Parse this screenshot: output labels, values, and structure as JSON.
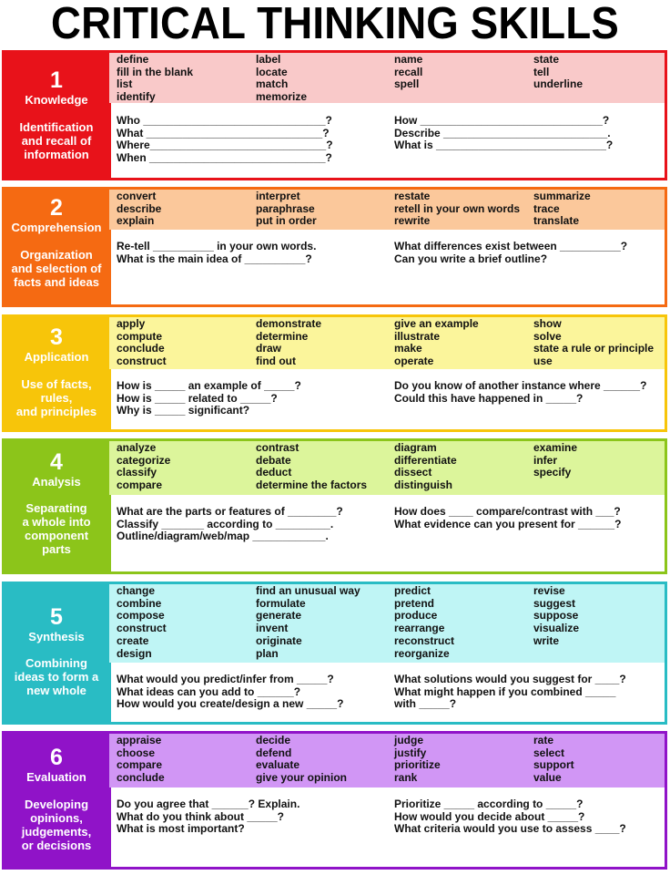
{
  "title": "CRITICAL THINKING SKILLS",
  "sections": [
    {
      "number": "1",
      "level": "Knowledge",
      "description": [
        "Identification",
        "and recall of",
        "information"
      ],
      "color": "#e8121a",
      "light_color": "#f9c9c9",
      "verbs": [
        [
          "define",
          "fill in the blank",
          "list",
          "identify"
        ],
        [
          "label",
          "locate",
          "match",
          "memorize"
        ],
        [
          "name",
          "recall",
          "spell"
        ],
        [
          "state",
          "tell",
          "underline"
        ]
      ],
      "questions_left": [
        "Who ______________________________?",
        "What _____________________________?",
        "Where_____________________________?",
        "When _____________________________?"
      ],
      "questions_right": [
        "How ______________________________?",
        "Describe ___________________________.",
        "What is ____________________________?"
      ]
    },
    {
      "number": "2",
      "level": "Comprehension",
      "description": [
        "Organization",
        "and selection of",
        "facts and ideas"
      ],
      "color": "#f56a12",
      "light_color": "#fbc89b",
      "verbs": [
        [
          "convert",
          "describe",
          "explain"
        ],
        [
          "interpret",
          "paraphrase",
          "put in order"
        ],
        [
          "restate",
          "retell in your own words",
          "rewrite"
        ],
        [
          "summarize",
          "trace",
          "translate"
        ]
      ],
      "questions_left": [
        "Re-tell __________ in your own words.",
        "What is the main idea of __________?"
      ],
      "questions_right": [
        "What differences exist between __________?",
        "Can you write a brief outline?"
      ]
    },
    {
      "number": "3",
      "level": "Application",
      "description": [
        "Use of facts,",
        "rules,",
        "and principles"
      ],
      "color": "#f7c50a",
      "light_color": "#fbf59b",
      "verbs": [
        [
          "apply",
          "compute",
          "conclude",
          "construct"
        ],
        [
          "demonstrate",
          "determine",
          "draw",
          "find out"
        ],
        [
          "give an example",
          "illustrate",
          "make",
          "operate"
        ],
        [
          "show",
          "solve",
          "state a rule or principle",
          "use"
        ]
      ],
      "questions_left": [
        "How is _____ an example of _____?",
        "How is _____ related to _____?",
        "Why is _____ significant?"
      ],
      "questions_right": [
        "Do you know of another instance where ______?",
        "Could this have happened in _____?"
      ]
    },
    {
      "number": "4",
      "level": "Analysis",
      "description": [
        "Separating",
        "a whole into",
        "component",
        "parts"
      ],
      "color": "#8cc51a",
      "light_color": "#dcf59b",
      "verbs": [
        [
          "analyze",
          "categorize",
          "classify",
          "compare"
        ],
        [
          "contrast",
          "debate",
          "deduct",
          "determine the factors"
        ],
        [
          "diagram",
          "differentiate",
          "dissect",
          "distinguish"
        ],
        [
          "examine",
          "infer",
          "specify"
        ]
      ],
      "questions_left": [
        "What are the parts or features of ________?",
        "Classify _______ according to _________.",
        "Outline/diagram/web/map ____________."
      ],
      "questions_right": [
        "How does ____ compare/contrast with ___?",
        "What evidence can you present for ______?"
      ]
    },
    {
      "number": "5",
      "level": "Synthesis",
      "description": [
        "Combining",
        "ideas to form a",
        "new whole"
      ],
      "color": "#29bcc4",
      "light_color": "#bff5f5",
      "verbs": [
        [
          "change",
          "combine",
          "compose",
          "construct",
          "create",
          "design"
        ],
        [
          "find an unusual way",
          "formulate",
          "generate",
          "invent",
          "originate",
          "plan"
        ],
        [
          "predict",
          "pretend",
          "produce",
          "rearrange",
          "reconstruct",
          "reorganize"
        ],
        [
          "revise",
          "suggest",
          "suppose",
          "visualize",
          "write"
        ]
      ],
      "questions_left": [
        "What would you predict/infer from _____?",
        "What ideas can you add to ______?",
        "How would you create/design a new _____?"
      ],
      "questions_right": [
        "What solutions would you suggest for ____?",
        "What might happen if you combined _____",
        "with _____?"
      ]
    },
    {
      "number": "6",
      "level": "Evaluation",
      "description": [
        "Developing",
        "opinions,",
        "judgements,",
        "or decisions"
      ],
      "color": "#9013c8",
      "light_color": "#d196f5",
      "verbs": [
        [
          "appraise",
          "choose",
          "compare",
          "conclude"
        ],
        [
          "decide",
          "defend",
          "evaluate",
          "give your opinion"
        ],
        [
          "judge",
          "justify",
          "prioritize",
          "rank"
        ],
        [
          "rate",
          "select",
          "support",
          "value"
        ]
      ],
      "questions_left": [
        "Do you agree that ______? Explain.",
        "What do you think about _____?",
        "What is most important?"
      ],
      "questions_right": [
        "Prioritize _____ according to _____?",
        "How would you decide about _____?",
        "What criteria would you use to assess ____?"
      ]
    }
  ]
}
